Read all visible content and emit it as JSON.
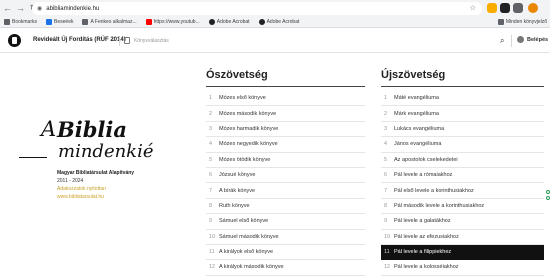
{
  "browser": {
    "url": "abibliamindenkie.hu",
    "bookmarks": [
      {
        "label": "Bookmarks",
        "color": "#5f6368"
      },
      {
        "label": "Beseéek",
        "color": "#1a73e8"
      },
      {
        "label": "A Fenkes alkalmaz...",
        "color": "#5f6368"
      },
      {
        "label": "https://www.youtub...",
        "color": "#ff0000"
      },
      {
        "label": "Adobe Acrobat",
        "color": "#202124"
      },
      {
        "label": "Adobe Acrobat",
        "color": "#202124"
      }
    ],
    "all_bookmarks": "Minden könyvjelző",
    "extension_colors": [
      "#f9ab00",
      "#202124",
      "#5f6368",
      "#ea8600"
    ]
  },
  "header": {
    "translation": "Revideált Új Fordítás (RÚF 2014)",
    "book_selector": "Könyvválasztás",
    "login": "Belépés"
  },
  "brand": {
    "a": "A",
    "biblia": "Biblia",
    "mindenkie": "mindenkié",
    "foundation": "Magyar Bibliatársulat Alapítvány",
    "years": "2011 - 2024",
    "subscribe": "Adakozzatok nyitottan",
    "site": "www.bibliatarsulat.hu"
  },
  "old_testament": {
    "title": "Ószövetség",
    "books": [
      {
        "n": "1",
        "name": "Mózes első könyve"
      },
      {
        "n": "2",
        "name": "Mózes második könyve"
      },
      {
        "n": "3",
        "name": "Mózes harmadik könyve"
      },
      {
        "n": "4",
        "name": "Mózes negyedik könyve"
      },
      {
        "n": "5",
        "name": "Mózes ötödik könyve"
      },
      {
        "n": "6",
        "name": "Józsué könyve"
      },
      {
        "n": "7",
        "name": "A bírák könyve"
      },
      {
        "n": "8",
        "name": "Ruth könyve"
      },
      {
        "n": "9",
        "name": "Sámuel első könyve"
      },
      {
        "n": "10",
        "name": "Sámuel második könyve"
      },
      {
        "n": "11",
        "name": "A királyok első könyve"
      },
      {
        "n": "12",
        "name": "A királyok második könyve"
      }
    ]
  },
  "new_testament": {
    "title": "Újszövetség",
    "books": [
      {
        "n": "1",
        "name": "Máté evangéliuma"
      },
      {
        "n": "2",
        "name": "Márk evangéliuma"
      },
      {
        "n": "3",
        "name": "Lukács evangéliuma"
      },
      {
        "n": "4",
        "name": "János evangéliuma"
      },
      {
        "n": "5",
        "name": "Az apostolok cselekedetei"
      },
      {
        "n": "6",
        "name": "Pál levele a rómaiakhoz"
      },
      {
        "n": "7",
        "name": "Pál első levele a korinthusiakhoz"
      },
      {
        "n": "8",
        "name": "Pál második levele a korinthusiakhoz"
      },
      {
        "n": "9",
        "name": "Pál levele a galatákhoz"
      },
      {
        "n": "10",
        "name": "Pál levele az efezusiakhoz"
      },
      {
        "n": "11",
        "name": "Pál levele a filippiekhez",
        "active": true
      },
      {
        "n": "12",
        "name": "Pál levele a kolosséiakhoz"
      }
    ]
  }
}
